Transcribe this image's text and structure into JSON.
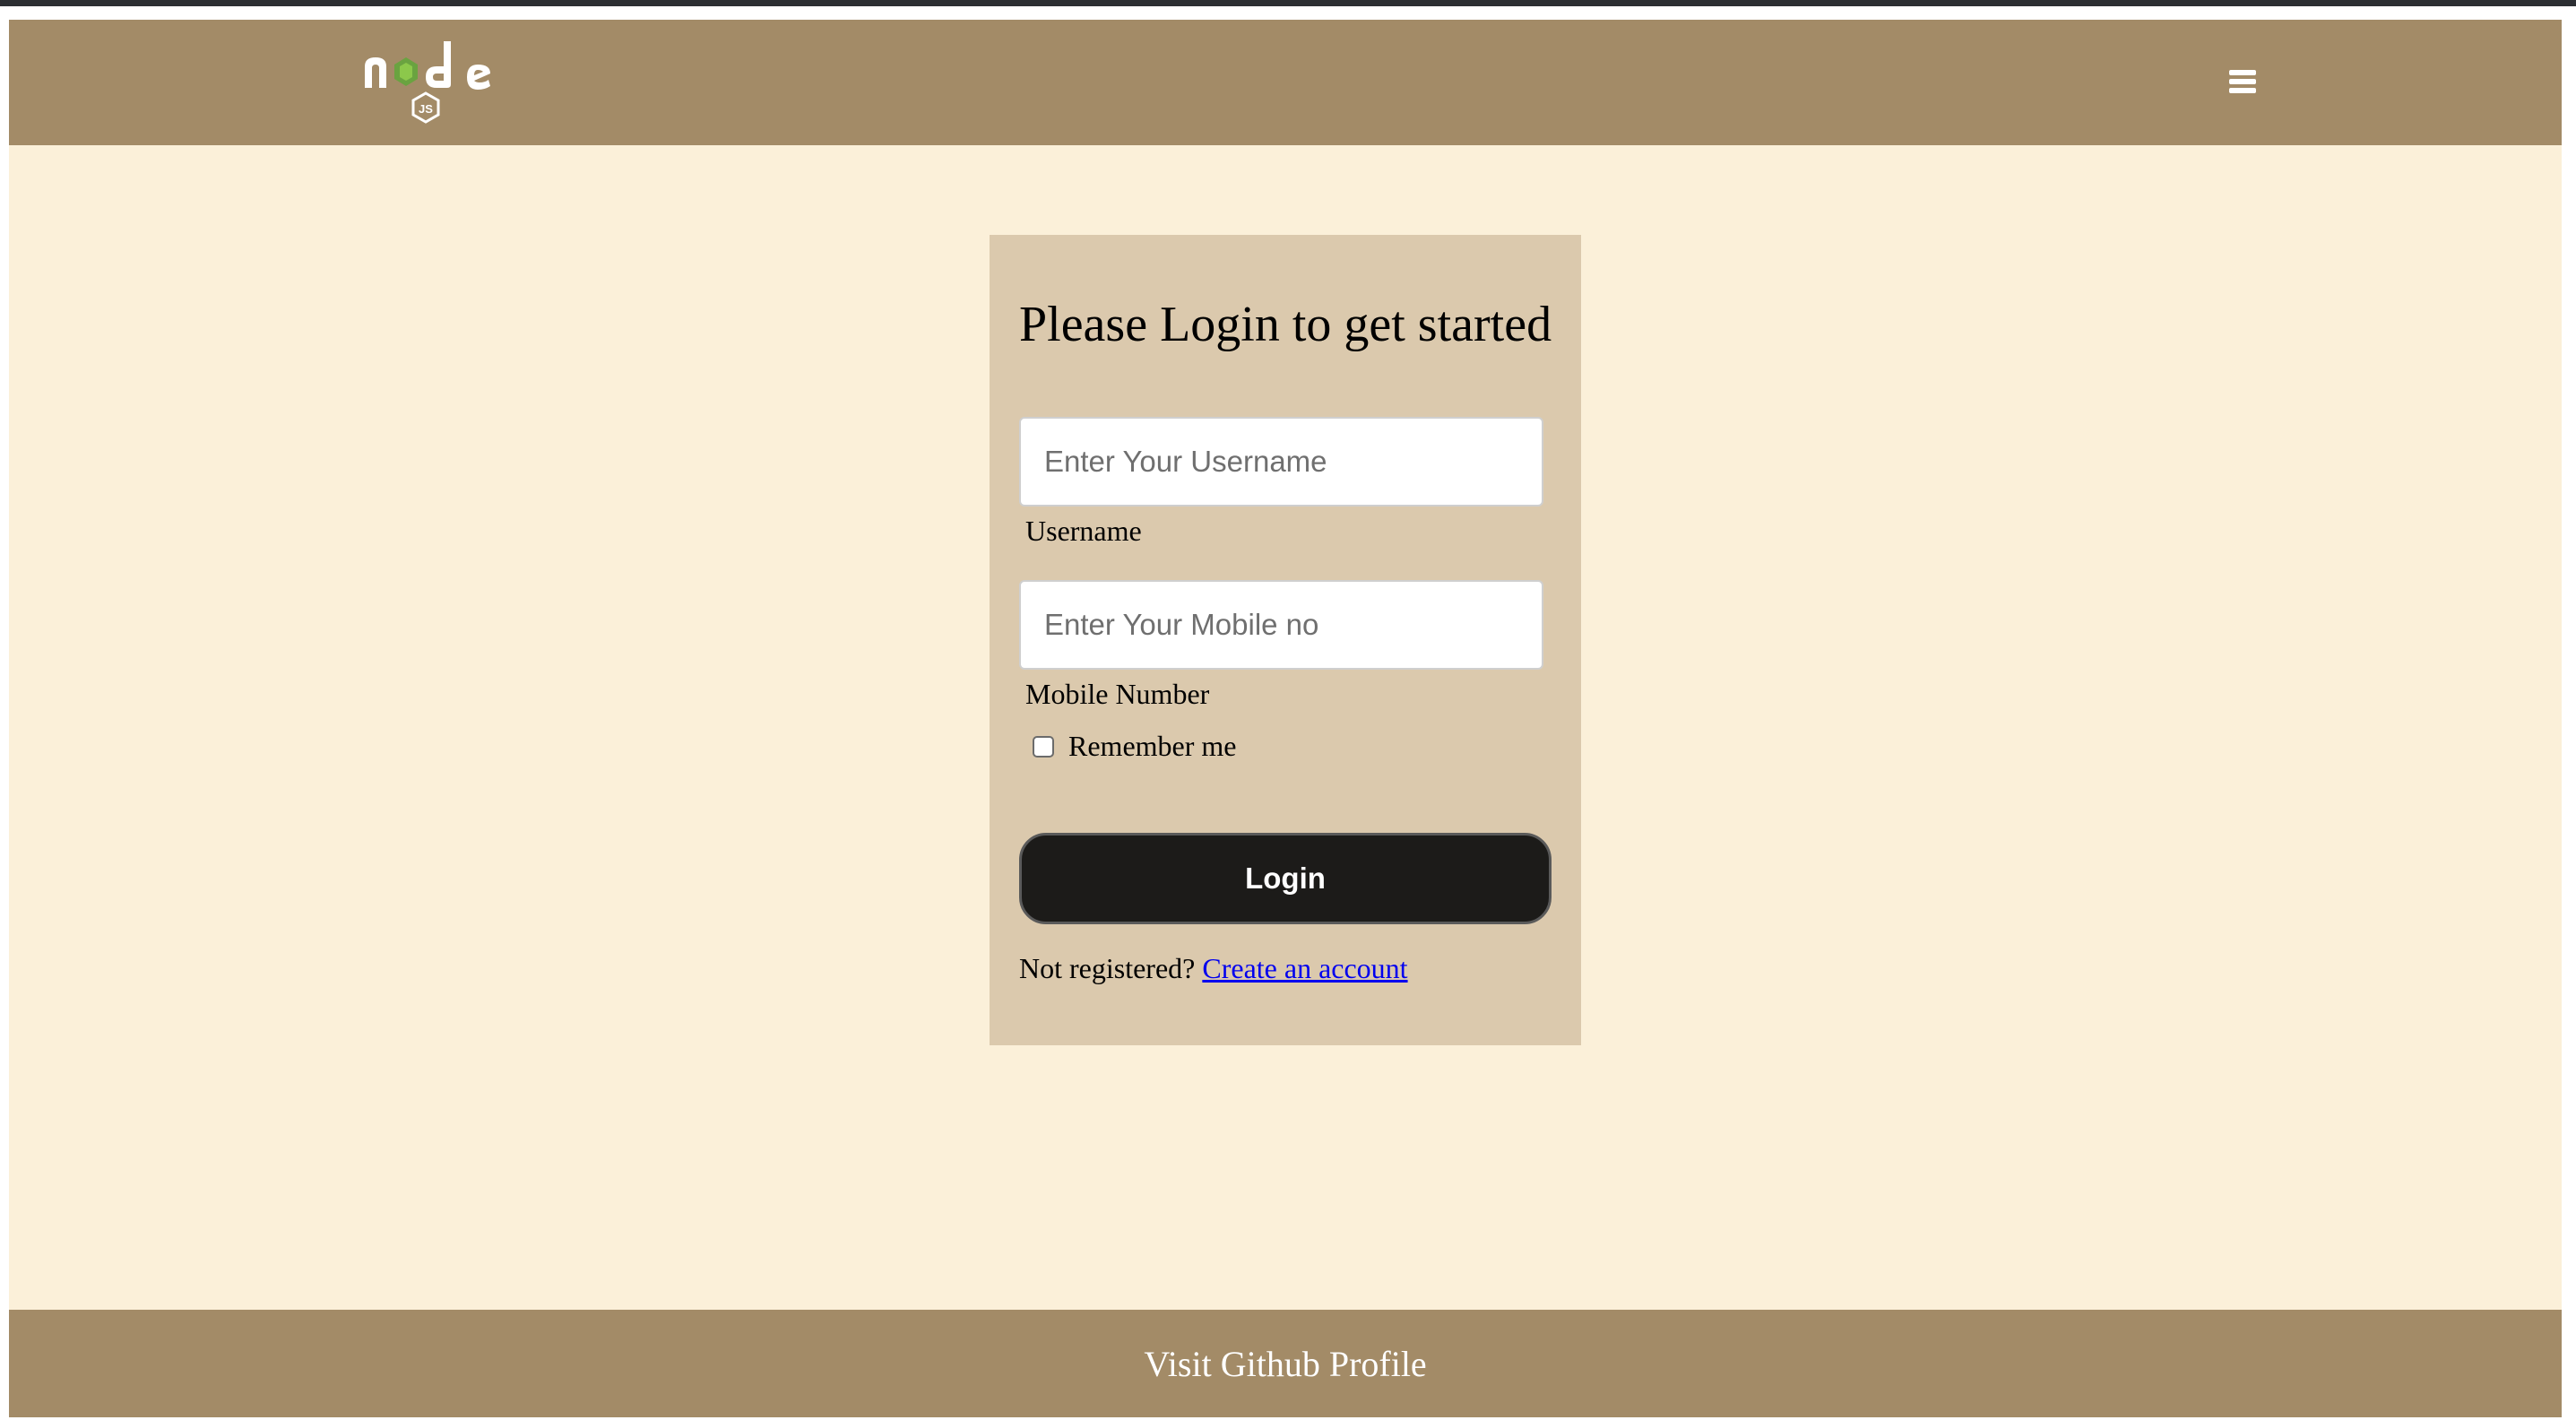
{
  "header": {
    "logo_alt": "node js",
    "menu_icon": "hamburger-menu-icon",
    "background_color": "#a38b67"
  },
  "login": {
    "title": "Please Login to get started",
    "username": {
      "placeholder": "Enter Your Username",
      "label": "Username",
      "value": ""
    },
    "mobile": {
      "placeholder": "Enter Your Mobile no",
      "label": "Mobile Number",
      "value": ""
    },
    "remember_label": "Remember me",
    "remember_checked": false,
    "submit_label": "Login",
    "signup_prompt": "Not registered?",
    "signup_link": "Create an account",
    "link_color": "#0000ee",
    "button_color": "#1c1b19"
  },
  "footer": {
    "link": "Visit Github Profile"
  },
  "colors": {
    "page_background": "#fbf0d9",
    "card_background": "#dbc9ad",
    "node_green": "#6aa340"
  }
}
